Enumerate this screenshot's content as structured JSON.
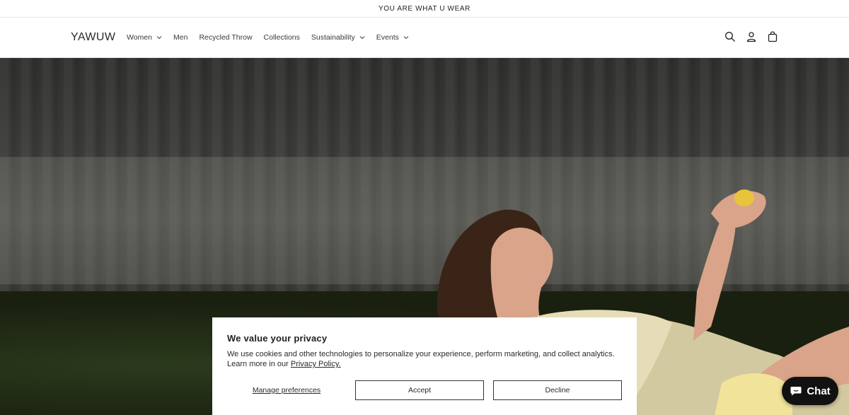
{
  "announcement": {
    "text": "YOU ARE WHAT U WEAR"
  },
  "header": {
    "logo": "YAWUW",
    "nav": [
      {
        "label": "Women",
        "dropdown": true
      },
      {
        "label": "Men",
        "dropdown": false
      },
      {
        "label": "Recycled Throw",
        "dropdown": false
      },
      {
        "label": "Collections",
        "dropdown": false
      },
      {
        "label": "Sustainability",
        "dropdown": true
      },
      {
        "label": "Events",
        "dropdown": true
      }
    ],
    "icons": [
      "search-icon",
      "account-icon",
      "cart-icon"
    ]
  },
  "cookie_banner": {
    "title": "We value your privacy",
    "text": "We use cookies and other technologies to personalize your experience, perform marketing, and collect analytics. Learn more in our ",
    "policy_link": "Privacy Policy.",
    "manage_label": "Manage preferences",
    "accept_label": "Accept",
    "decline_label": "Decline"
  },
  "chat": {
    "label": "Chat",
    "icon": "chat-bubble-icon"
  },
  "colors": {
    "chat_bg": "#111111",
    "text": "#1f1f1f",
    "border": "#333333"
  }
}
